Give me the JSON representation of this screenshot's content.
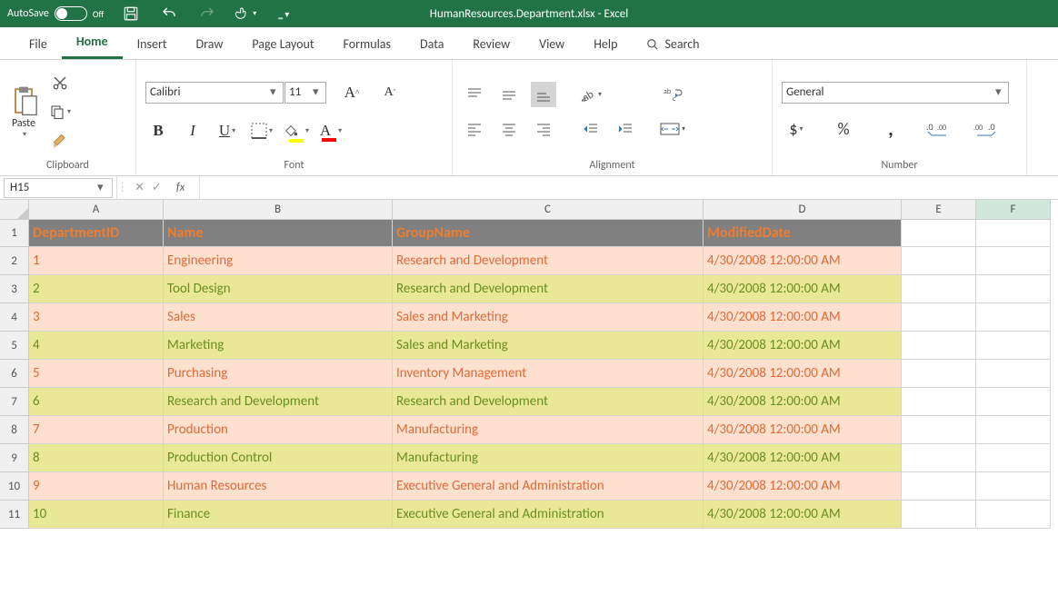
{
  "title_bar": {
    "autosave_label": "AutoSave",
    "autosave_state": "Off",
    "doc_name": "HumanResources.Department.xlsx",
    "app_suffix": "  -  Excel"
  },
  "tabs": {
    "file": "File",
    "home": "Home",
    "insert": "Insert",
    "draw": "Draw",
    "page_layout": "Page Layout",
    "formulas": "Formulas",
    "data": "Data",
    "review": "Review",
    "view": "View",
    "help": "Help",
    "search": "Search"
  },
  "ribbon": {
    "clipboard": {
      "paste": "Paste",
      "label": "Clipboard"
    },
    "font": {
      "name": "Calibri",
      "size": "11",
      "label": "Font"
    },
    "alignment": {
      "label": "Alignment"
    },
    "number": {
      "format": "General",
      "label": "Number"
    }
  },
  "namebox": "H15",
  "columns": [
    "A",
    "B",
    "C",
    "D",
    "E",
    "F"
  ],
  "table": {
    "headers": [
      "DepartmentID",
      "Name",
      "GroupName",
      "ModifiedDate"
    ],
    "rows": [
      [
        "1",
        "Engineering",
        "Research and Development",
        "4/30/2008 12:00:00 AM"
      ],
      [
        "2",
        "Tool Design",
        "Research and Development",
        "4/30/2008 12:00:00 AM"
      ],
      [
        "3",
        "Sales",
        "Sales and Marketing",
        "4/30/2008 12:00:00 AM"
      ],
      [
        "4",
        "Marketing",
        "Sales and Marketing",
        "4/30/2008 12:00:00 AM"
      ],
      [
        "5",
        "Purchasing",
        "Inventory Management",
        "4/30/2008 12:00:00 AM"
      ],
      [
        "6",
        "Research and Development",
        "Research and Development",
        "4/30/2008 12:00:00 AM"
      ],
      [
        "7",
        "Production",
        "Manufacturing",
        "4/30/2008 12:00:00 AM"
      ],
      [
        "8",
        "Production Control",
        "Manufacturing",
        "4/30/2008 12:00:00 AM"
      ],
      [
        "9",
        "Human Resources",
        "Executive General and Administration",
        "4/30/2008 12:00:00 AM"
      ],
      [
        "10",
        "Finance",
        "Executive General and Administration",
        "4/30/2008 12:00:00 AM"
      ]
    ]
  }
}
